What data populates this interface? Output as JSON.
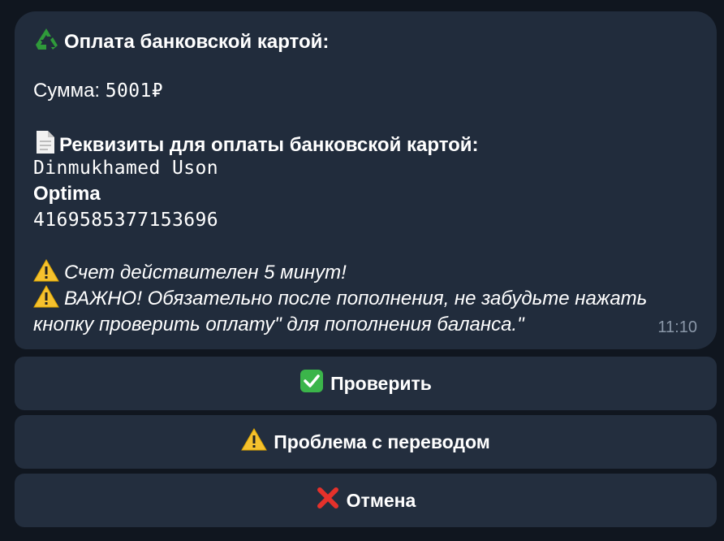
{
  "message": {
    "title": "Оплата банковской картой:",
    "sum_label": "Сумма:",
    "sum_value": "5001₽",
    "requisites_title": "Реквизиты для оплаты банковской картой:",
    "card_holder": "Dinmukhamed Uson",
    "bank": "Optima",
    "card_number": "4169585377153696",
    "warning_1": "Счет действителен 5 минут!",
    "warning_2_line_1": "ВАЖНО! Обязательно после пополнения, не забудьте нажать",
    "warning_2_line_2": "кнопку проверить оплату\" для пополнения баланса.\"",
    "time": "11:10"
  },
  "buttons": {
    "check": "Проверить",
    "problem": "Проблема с переводом",
    "cancel": "Отмена"
  },
  "icons": {
    "title": "recycle-icon",
    "requisites": "document-icon",
    "warning": "warning-icon",
    "check": "check-icon",
    "cancel": "cross-icon"
  },
  "colors": {
    "background": "#10161f",
    "bubble": "#212c3c",
    "button": "#232e3e",
    "text": "#ffffff",
    "timestamp": "#8a97a8"
  }
}
